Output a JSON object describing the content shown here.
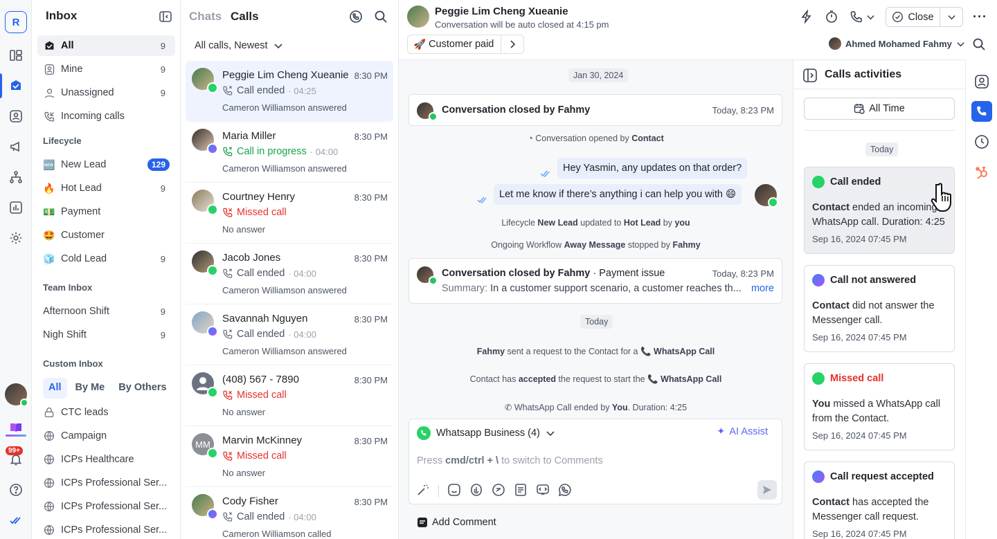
{
  "rail": {
    "logo_letter": "R",
    "notif_badge": "99+"
  },
  "inbox": {
    "title": "Inbox",
    "main": [
      {
        "label": "All",
        "count": "9"
      },
      {
        "label": "Mine",
        "count": "9"
      },
      {
        "label": "Unassigned",
        "count": "9"
      },
      {
        "label": "Incoming calls",
        "count": ""
      }
    ],
    "lifecycle_title": "Lifecycle",
    "lifecycle": [
      {
        "emoji": "🆕",
        "label": "New Lead",
        "count": "129"
      },
      {
        "emoji": "🔥",
        "label": "Hot Lead",
        "count": "9"
      },
      {
        "emoji": "💵",
        "label": "Payment",
        "count": ""
      },
      {
        "emoji": "🤩",
        "label": "Customer",
        "count": ""
      },
      {
        "emoji": "🧊",
        "label": "Cold Lead",
        "count": "9"
      }
    ],
    "team_title": "Team Inbox",
    "team": [
      {
        "label": "Afternoon Shift",
        "count": "9"
      },
      {
        "label": "Nigh Shift",
        "count": "9"
      }
    ],
    "custom_title": "Custom Inbox",
    "seg": [
      "All",
      "By Me",
      "By Others"
    ],
    "custom": [
      "CTC leads",
      "Campaign",
      "ICPs Healthcare",
      "ICPs Professional Ser...",
      "ICPs Professional Ser...",
      "ICPs Professional Ser..."
    ]
  },
  "calls": {
    "tab_chats": "Chats",
    "tab_calls": "Calls",
    "filter": "All calls, Newest",
    "items": [
      {
        "name": "Peggie Lim Cheng Xueanie",
        "time": "8:30 PM",
        "status": "Call ended",
        "dur": "· 04:25",
        "sub": "Cameron Williamson answered",
        "kind": "ended",
        "ch": "wa"
      },
      {
        "name": "Maria Miller",
        "time": "8:30 PM",
        "status": "Call in progress",
        "dur": "· 04:00",
        "sub": "Cameron Williamson answered",
        "kind": "progress",
        "ch": "ms"
      },
      {
        "name": "Courtney Henry",
        "time": "8:30 PM",
        "status": "Missed call",
        "dur": "",
        "sub": "No answer",
        "kind": "missed",
        "ch": "wa"
      },
      {
        "name": "Jacob Jones",
        "time": "8:30 PM",
        "status": "Call ended",
        "dur": "· 04:00",
        "sub": "Cameron Williamson answered",
        "kind": "ended",
        "ch": "wa"
      },
      {
        "name": "Savannah Nguyen",
        "time": "8:30 PM",
        "status": "Call ended",
        "dur": "· 04:00",
        "sub": "Cameron Williamson answered",
        "kind": "ended",
        "ch": "ms"
      },
      {
        "name": "(408) 567 - 7890",
        "time": "8:30 PM",
        "status": "Missed call",
        "dur": "",
        "sub": "No answer",
        "kind": "missed",
        "ch": "wa"
      },
      {
        "name": "Marvin McKinney",
        "time": "8:30 PM",
        "status": "Missed call",
        "dur": "",
        "sub": "No answer",
        "kind": "missed",
        "ch": "wa",
        "initials": "MM"
      },
      {
        "name": "Cody Fisher",
        "time": "8:30 PM",
        "status": "Call ended",
        "dur": "· 04:00",
        "sub": "Cameron Williamson called",
        "kind": "ended",
        "ch": "ms"
      }
    ]
  },
  "chat": {
    "name": "Peggie Lim Cheng Xueanie",
    "sub": "Conversation will be auto closed at 4:15 pm",
    "tag": "Customer paid",
    "close": "Close",
    "agent": "Ahmed Mohamed Fahmy",
    "date1": "Jan 30, 2024",
    "closed1_title": "Conversation closed by Fahmy",
    "closed1_time": "Today, 8:23 PM",
    "opened": {
      "pre": "Conversation opened by ",
      "b": "Contact"
    },
    "msg1": "Hey Yasmin, any updates on that order?",
    "msg2": "Let me know if there’s anything i can help you with 😄",
    "lifecycle_line": {
      "a": "Lifecycle ",
      "b1": "New Lead",
      "c": " updated to ",
      "b2": "Hot Lead",
      "d": " by ",
      "b3": "you"
    },
    "workflow_line": {
      "a": "Ongoing Workflow ",
      "b1": "Away Message",
      "c": " stopped by ",
      "b2": "Fahmy"
    },
    "closed2_title": "Conversation closed by Fahmy",
    "closed2_topic": "· Payment issue",
    "closed2_time": "Today, 8:23 PM",
    "closed2_summary_label": "Summary:",
    "closed2_summary": "In a customer support scenario, a customer reaches th...",
    "more": "more",
    "date2": "Today",
    "req_line": {
      "b1": "Fahmy",
      "a": " sent a request to the Contact for a ",
      "b2": "WhatsApp Call"
    },
    "acc_line": {
      "a": "Contact has ",
      "b1": "accepted",
      "c": " the request to start the ",
      "b2": "WhatsApp Call"
    },
    "end_line": {
      "a": "WhatsApp Call ended by ",
      "b1": "You",
      "c": ". Duration: 4:25"
    },
    "composer_source": "Whatsapp Business (4)",
    "ai_assist": "AI Assist",
    "placeholder_pre": "Press ",
    "placeholder_b": "cmd/ctrl + \\",
    "placeholder_post": " to switch to Comments",
    "add_comment": "Add Comment"
  },
  "acts": {
    "title": "Calls activities",
    "all_time": "All Time",
    "today": "Today",
    "cards": [
      {
        "title": "Call ended",
        "b": "Contact",
        "body": " ended an incoming WhatsApp call. Duration: 4:25",
        "date": "Sep 16, 2024 07:45 PM",
        "ch": "wa",
        "red": false
      },
      {
        "title": "Call not answered",
        "b": "Contact",
        "body": " did not answer the Messenger call.",
        "date": "Sep 16, 2024 07:45 PM",
        "ch": "ms",
        "red": false
      },
      {
        "title": "Missed call",
        "b": "You",
        "body": " missed a WhatsApp call from the Contact.",
        "date": "Sep 16, 2024 07:45 PM",
        "ch": "wa",
        "red": true
      },
      {
        "title": "Call request accepted",
        "b": "Contact",
        "body": " has accepted the Messenger call request.",
        "date": "Sep 16, 2024 07:45 PM",
        "ch": "ms",
        "red": false
      }
    ]
  },
  "colors": {
    "accent": "#2563eb",
    "whatsapp": "#25d366",
    "messenger": "#7b5cff",
    "missed": "#e5322d",
    "progress": "#16a34a",
    "hubspot": "#ff7a59"
  }
}
